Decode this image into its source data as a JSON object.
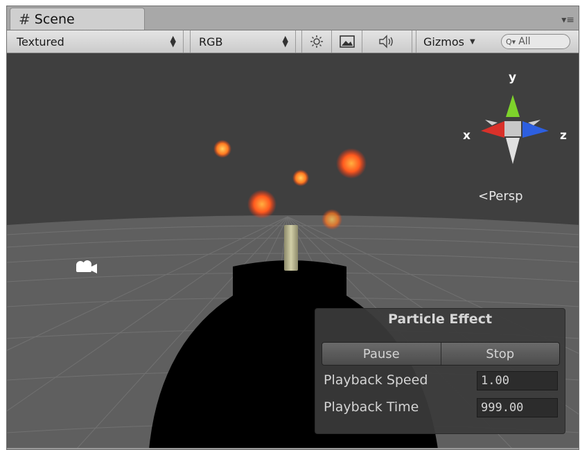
{
  "tab": {
    "title": "Scene",
    "hash_icon": "#",
    "menu_icon": "▾≡"
  },
  "toolbar": {
    "draw_mode": "Textured",
    "render_mode": "RGB",
    "gizmos_label": "Gizmos",
    "search_placeholder": "All",
    "search_icon": "Q▾"
  },
  "gizmo": {
    "y": "y",
    "x": "x",
    "z": "z",
    "persp_label": "Persp",
    "persp_prefix": "<"
  },
  "particle_panel": {
    "title": "Particle Effect",
    "pause_label": "Pause",
    "stop_label": "Stop",
    "speed_label": "Playback Speed",
    "speed_value": "1.00",
    "time_label": "Playback Time",
    "time_value": "999.00"
  }
}
